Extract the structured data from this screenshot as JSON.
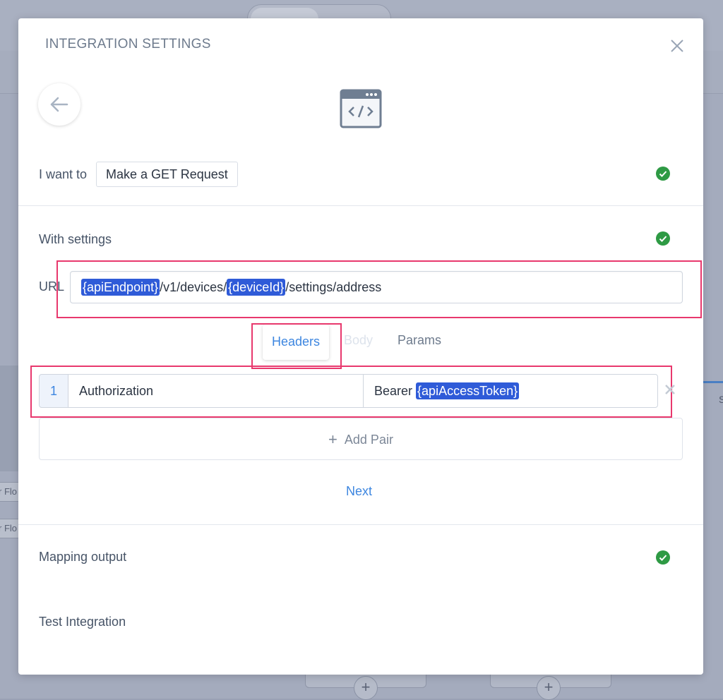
{
  "background": {
    "chip_text": "r Flo",
    "right_char": "S",
    "plus_symbol": "+"
  },
  "modal": {
    "title": "INTEGRATION SETTINGS",
    "app_icon": "code-window-icon",
    "action": {
      "label": "I want to",
      "value": "Make a GET Request"
    },
    "settings": {
      "label": "With settings",
      "url_label": "URL",
      "url_parts": {
        "token1": "{apiEndpoint}",
        "text1": "/v1/devices/",
        "token2": "{deviceId}",
        "text2": "/settings/address"
      }
    },
    "tabs": {
      "headers": "Headers",
      "body": "Body",
      "params": "Params"
    },
    "headers": [
      {
        "index": "1",
        "key": "Authorization",
        "value_prefix": "Bearer ",
        "value_token": "{apiAccessToken}"
      }
    ],
    "add_pair_label": "Add Pair",
    "add_pair_symbol": "+",
    "next_label": "Next",
    "mapping_output_label": "Mapping output",
    "test_integration_label": "Test Integration"
  },
  "colors": {
    "accent": "#3d86e0",
    "token_bg": "#2f5bd8",
    "success": "#2e9a44",
    "highlight": "#e8386d"
  }
}
